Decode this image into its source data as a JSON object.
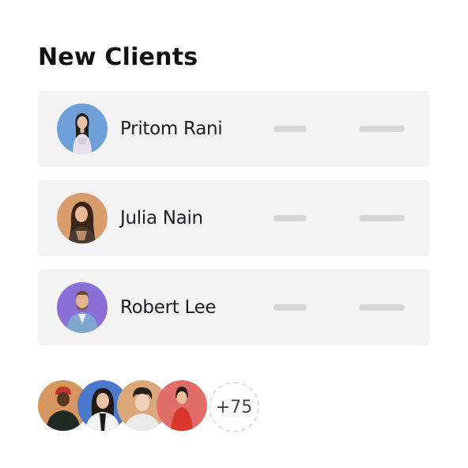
{
  "title": "New Clients",
  "clients": [
    {
      "name": "Pritom Rani",
      "avatar_bg": "#6f9fd8"
    },
    {
      "name": "Julia Nain",
      "avatar_bg": "#d99c6c"
    },
    {
      "name": "Robert Lee",
      "avatar_bg": "#8b6fd6"
    }
  ],
  "stack_avatars": [
    {
      "bg": "#d7965f"
    },
    {
      "bg": "#4b79cc"
    },
    {
      "bg": "#d9a77a"
    },
    {
      "bg": "#e06d67"
    }
  ],
  "more_count": "+75",
  "colors": {
    "card_bg": "#f3f3f3",
    "placeholder": "#d6d6d6"
  }
}
